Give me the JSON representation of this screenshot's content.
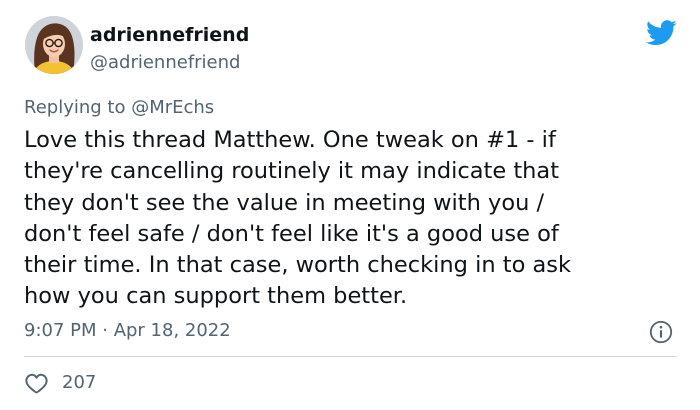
{
  "author": {
    "display_name": "adriennefriend",
    "handle": "@adriennefriend"
  },
  "reply": {
    "prefix": "Replying to ",
    "mention": "@MrEchs"
  },
  "tweet": {
    "text": "Love this thread Matthew. One tweak on #1 - if\nthey're cancelling routinely it may indicate that\nthey don't see the value in meeting with you /\ndon't feel safe / don't feel like it's a good use of\ntheir time. In that case, worth checking in to ask\nhow you can support them better."
  },
  "meta": {
    "timestamp": "9:07 PM · Apr 18, 2022"
  },
  "actions": {
    "like_count": "207"
  },
  "icons": {
    "brand": "twitter-bird-icon",
    "info": "info-icon",
    "like": "heart-icon"
  },
  "colors": {
    "brand_blue": "#1d9bf0",
    "text_primary": "#0f1419",
    "text_secondary": "#536471",
    "divider": "#cfd9de"
  }
}
